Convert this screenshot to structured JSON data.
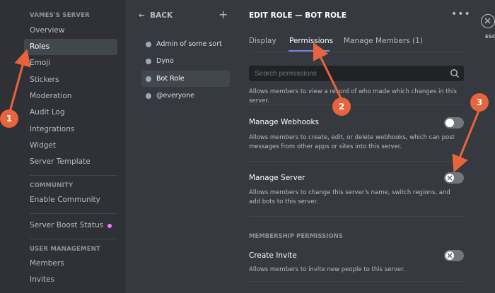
{
  "sidebar": {
    "server_header": "VAMES'S SERVER",
    "items": [
      "Overview",
      "Roles",
      "Emoji",
      "Stickers",
      "Moderation",
      "Audit Log",
      "Integrations",
      "Widget",
      "Server Template"
    ],
    "community_header": "COMMUNITY",
    "community_items": [
      "Enable Community"
    ],
    "boost_label": "Server Boost Status",
    "user_mgmt_header": "USER MANAGEMENT",
    "user_items": [
      "Members",
      "Invites"
    ],
    "active": "Roles"
  },
  "roles_column": {
    "back_label": "BACK",
    "add_symbol": "+",
    "roles": [
      "Admin of some sort",
      "Dyno",
      "Bot Role",
      "@everyone"
    ],
    "active": "Bot Role"
  },
  "main": {
    "title": "EDIT ROLE — BOT ROLE",
    "more_symbol": "•••",
    "tabs": [
      "Display",
      "Permissions",
      "Manage Members (1)"
    ],
    "active_tab": "Permissions",
    "search_placeholder": "Search permissions",
    "top_desc": "Allows members to view a record of who made which changes in this server.",
    "permissions": [
      {
        "name": "Manage Webhooks",
        "desc": "Allows members to create, edit, or delete webhooks, which can post messages from other apps or sites into this server.",
        "enabled": false
      },
      {
        "name": "Manage Server",
        "desc": "Allows members to change this server's name, switch regions, and add bots to this server.",
        "enabled": false
      }
    ],
    "membership_header": "MEMBERSHIP PERMISSIONS",
    "membership_permissions": [
      {
        "name": "Create Invite",
        "desc": "Allows members to invite new people to this server.",
        "enabled": false
      }
    ]
  },
  "close": {
    "label": "ESC"
  },
  "annotations": [
    "1",
    "2",
    "3"
  ],
  "colors": {
    "annotation": "#e8643c",
    "accent": "#7289da",
    "boost": "#ff73fa"
  }
}
